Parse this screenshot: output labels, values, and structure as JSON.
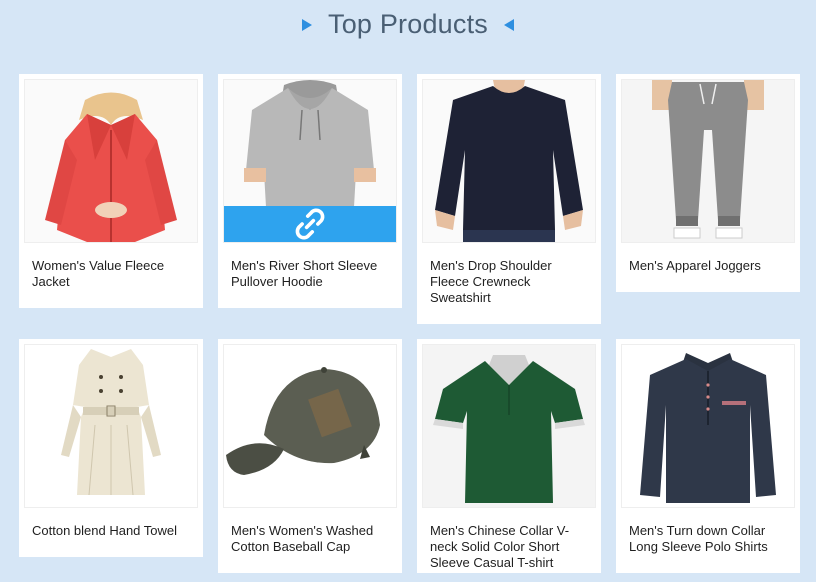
{
  "section": {
    "title": "Top Products"
  },
  "products": [
    {
      "name": "Women's Value Fleece Jacket",
      "image": "red-fleece-jacket"
    },
    {
      "name": "Men's River Short Sleeve Pullover Hoodie",
      "image": "grey-short-sleeve-hoodie",
      "hover_icon": "link-icon"
    },
    {
      "name": "Men's Drop Shoulder Fleece Crewneck Sweatshirt",
      "image": "navy-crewneck-sweatshirt"
    },
    {
      "name": "Men's Apparel Joggers",
      "image": "grey-joggers"
    },
    {
      "name": "Cotton blend Hand Towel",
      "image": "cream-trench-coat"
    },
    {
      "name": "Men's Women's Washed Cotton Baseball Cap",
      "image": "olive-baseball-cap"
    },
    {
      "name": "Men's Chinese Collar V-neck Solid Color Short Sleeve Casual T-shirt",
      "image": "green-collar-tshirt"
    },
    {
      "name": "Men's Turn down Collar Long Sleeve Polo Shirts",
      "image": "navy-long-sleeve-polo"
    }
  ],
  "colors": {
    "background": "#d6e6f6",
    "accent": "#2ea3ee",
    "title_text": "#4a5f74"
  }
}
